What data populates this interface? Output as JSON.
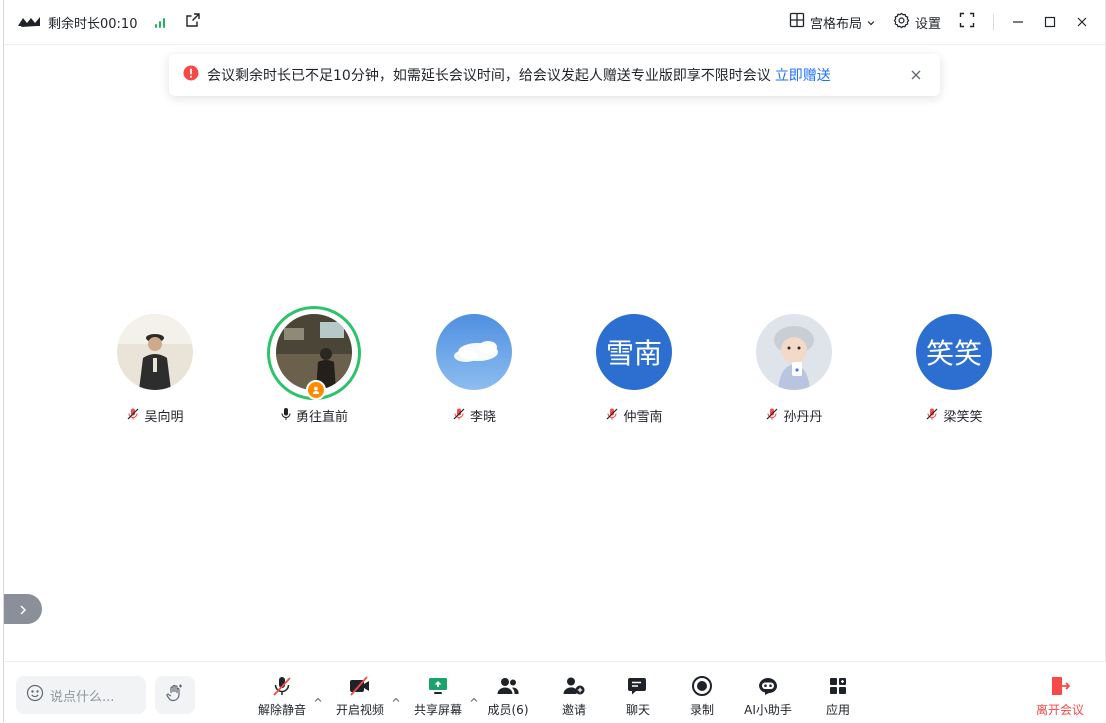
{
  "topbar": {
    "remaining_time": "剩余时长00:10",
    "layout_label": "宫格布局",
    "settings_label": "设置"
  },
  "notice": {
    "message": "会议剩余时长已不足10分钟，如需延长会议时间，给会议发起人赠送专业版即享不限时会议",
    "link": "立即赠送"
  },
  "participants": [
    {
      "name": "吴向明",
      "avatar": "photo-uniform",
      "mic": "muted"
    },
    {
      "name": "勇往直前",
      "avatar": "photo-room",
      "mic": "speaking",
      "host": true
    },
    {
      "name": "李晓",
      "avatar": "photo-sky",
      "mic": "muted"
    },
    {
      "name": "仲雪南",
      "avatar_text": "雪南",
      "mic": "muted"
    },
    {
      "name": "孙丹丹",
      "avatar": "photo-child",
      "mic": "muted"
    },
    {
      "name": "梁笑笑",
      "avatar_text": "笑笑",
      "mic": "muted"
    }
  ],
  "toolbar": {
    "chat_placeholder": "说点什么...",
    "unmute": "解除静音",
    "start_video": "开启视频",
    "share_screen": "共享屏幕",
    "members": "成员(6)",
    "invite": "邀请",
    "chat": "聊天",
    "record": "录制",
    "ai_assistant": "AI小助手",
    "apps": "应用",
    "leave": "离开会议"
  },
  "colors": {
    "accent_blue": "#1e6fff",
    "speaking_green": "#2cc36b",
    "danger_red": "#f54a45",
    "avatar_blue": "#2d6fd0",
    "share_green": "#1aa36b"
  }
}
